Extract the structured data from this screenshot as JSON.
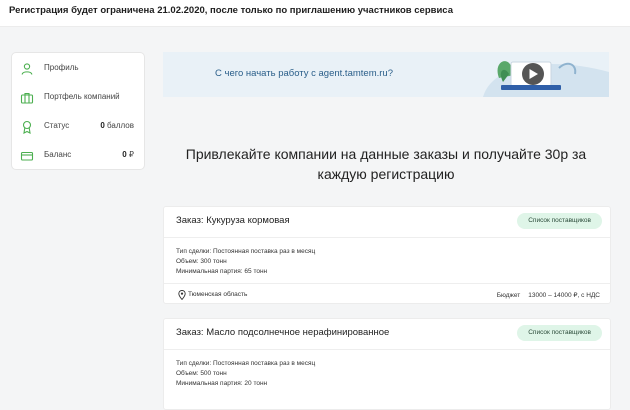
{
  "notice": "Регистрация будет ограничена 21.02.2020, после только по приглашению участников сервиса",
  "sidebar": {
    "items": [
      {
        "label": "Профиль",
        "icon": "user-icon"
      },
      {
        "label": "Портфель компаний",
        "icon": "briefcase-icon"
      },
      {
        "label": "Статус",
        "value_num": "0",
        "value_unit": "баллов",
        "icon": "award-icon"
      },
      {
        "label": "Баланс",
        "value_num": "0",
        "value_unit": "₽",
        "icon": "card-icon"
      }
    ]
  },
  "banner": {
    "text": "С чего начать работу с agent.tamtem.ru?",
    "icon": "play-icon"
  },
  "headline": {
    "line1": "Привлекайте компании на данные заказы и получайте 30р за",
    "line2": "каждую регистрацию"
  },
  "orders": [
    {
      "title": "Заказ: Кукуруза кормовая",
      "button": "Список поставщиков",
      "deal_type": "Тип сделки: Постоянная поставка раз в месяц",
      "volume": "Объем: 300 тонн",
      "min_batch": "Минимальная партия: 65 тонн",
      "location": "Тюменская область",
      "budget_label": "Бюджет",
      "budget_value": "13000 – 14000 ₽, с НДС"
    },
    {
      "title": "Заказ: Масло подсолнечное нерафинированное",
      "button": "Список поставщиков",
      "deal_type": "Тип сделки: Постоянная поставка раз в месяц",
      "volume": "Объем: 500 тонн",
      "min_batch": "Минимальная партия: 20 тонн"
    }
  ],
  "colors": {
    "accent_green": "#4caf50",
    "pill_bg": "#dff5e8",
    "banner_bg": "#e9f1f7",
    "link_blue": "#2b5f8a"
  }
}
